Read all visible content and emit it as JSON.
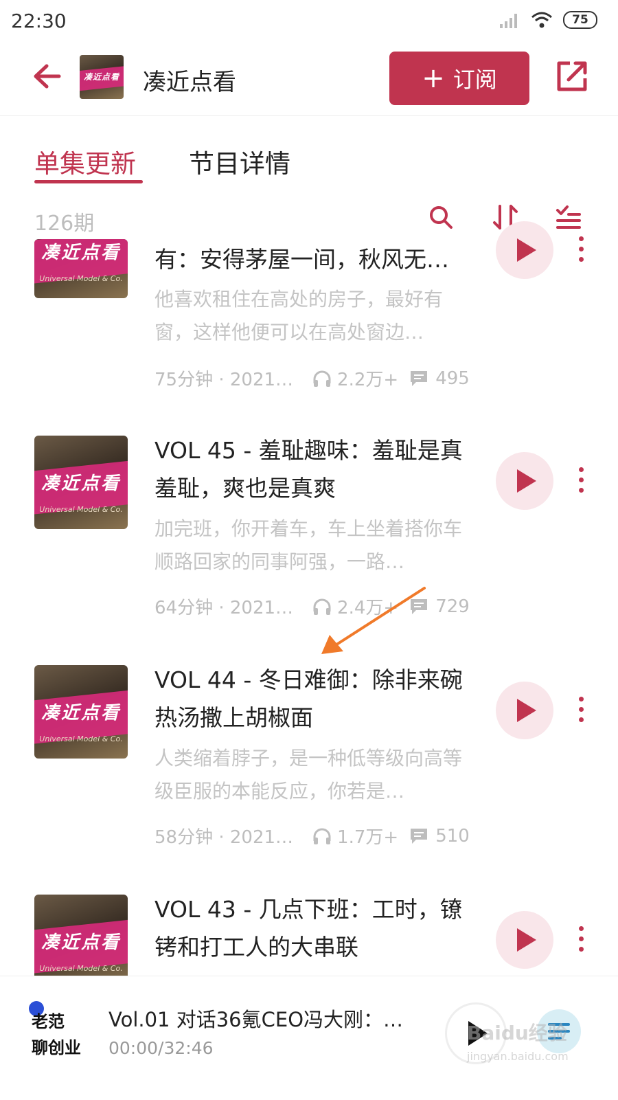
{
  "status_bar": {
    "time": "22:30",
    "battery": "75"
  },
  "header": {
    "podcast_title": "凑近点看",
    "subscribe_label": "订阅"
  },
  "cover_art": {
    "text": "凑近点看",
    "subtext": "Universal Model & Co."
  },
  "tabs": [
    {
      "label": "单集更新",
      "active": true
    },
    {
      "label": "节目详情",
      "active": false
    }
  ],
  "list": {
    "count": "126期"
  },
  "episodes": [
    {
      "title": "有：安得茅屋一间，秋风无…",
      "description": "他喜欢租住在高处的房子，最好有窗，这样他便可以在高处窗边…",
      "duration_date": "75分钟 · 2021…",
      "plays": "2.2万+",
      "comments": "495"
    },
    {
      "title": "VOL 45 - 羞耻趣味：羞耻是真羞耻，爽也是真爽",
      "description": "加完班，你开着车，车上坐着搭你车顺路回家的同事阿强，一路…",
      "duration_date": "64分钟 · 2021…",
      "plays": "2.4万+",
      "comments": "729"
    },
    {
      "title": "VOL 44 - 冬日难御：除非来碗热汤撒上胡椒面",
      "description": "人类缩着脖子，是一种低等级向高等级臣服的本能反应，你若是…",
      "duration_date": "58分钟 · 2021…",
      "plays": "1.7万+",
      "comments": "510"
    },
    {
      "title": "VOL 43 - 几点下班：工时，镣铐和打工人的大串联",
      "description": "",
      "duration_date": "",
      "plays": "",
      "comments": ""
    }
  ],
  "player": {
    "logo_line1": "老范",
    "logo_line2": "聊创业",
    "title": "Vol.01 对话36氪CEO冯大刚：…",
    "time": "00:00/32:46"
  },
  "watermark": {
    "line1": "Baidu经验",
    "line2": "jingyan.baidu.com"
  },
  "colors": {
    "accent": "#c0344f",
    "play_bg": "#f9e6ea",
    "muted": "#bdbdbd",
    "annotation": "#f07a2a"
  }
}
